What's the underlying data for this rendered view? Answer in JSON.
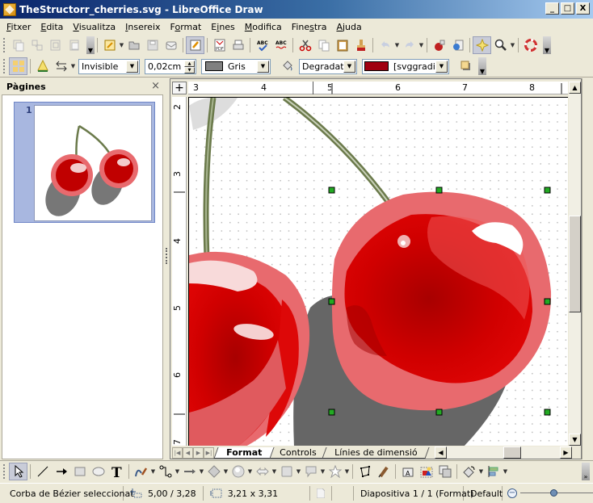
{
  "window": {
    "title": "TheStructorr_cherries.svg - LibreOffice Draw",
    "minimize_label": "_",
    "maximize_label": "□",
    "close_label": "X"
  },
  "menu": [
    {
      "label": "Fitxer",
      "accel": "F"
    },
    {
      "label": "Edita",
      "accel": "E"
    },
    {
      "label": "Visualitza",
      "accel": "V"
    },
    {
      "label": "Insereix",
      "accel": "I"
    },
    {
      "label": "Format",
      "accel": "o"
    },
    {
      "label": "Eines",
      "accel": "i"
    },
    {
      "label": "Modifica",
      "accel": "M"
    },
    {
      "label": "Finestra",
      "accel": "s"
    },
    {
      "label": "Ajuda",
      "accel": "A"
    }
  ],
  "standard_toolbar": {
    "icons": [
      "copy-slide-icon",
      "duplicate-icon",
      "copy-icon",
      "paste-special-icon",
      "new-icon",
      "open-icon",
      "save-icon",
      "email-icon",
      "edit-file-icon",
      "export-pdf-icon",
      "print-icon",
      "spellcheck-icon",
      "autospellcheck-icon",
      "cut-icon",
      "copy-icon",
      "paste-icon",
      "clone-formatting-icon",
      "undo-icon",
      "redo-icon",
      "gallery-icon",
      "navigator-icon",
      "functions-icon",
      "zoom-icon",
      "help-icon"
    ]
  },
  "line_fill_toolbar": {
    "line_style": "Invisible",
    "line_width": "0,02cm",
    "line_color_name": "Gris",
    "line_color": "#808080",
    "area_style": "Degradat",
    "area_fill_name": "[svggradier",
    "area_fill_color": "#a00010"
  },
  "pages_panel": {
    "title": "Pàgines",
    "close_label": "×",
    "slides": [
      {
        "number": "1"
      }
    ]
  },
  "rulers": {
    "horizontal": [
      "3",
      "4",
      "5",
      "6",
      "7",
      "8"
    ],
    "vertical": [
      "2",
      "3",
      "4",
      "5",
      "6",
      "7"
    ]
  },
  "layer_tabs": [
    {
      "label": "Format",
      "active": true
    },
    {
      "label": "Controls",
      "active": false
    },
    {
      "label": "Línies de dimensió",
      "active": false
    }
  ],
  "status": {
    "selection": "Corba de Bézier seleccionat",
    "position": "5,00 / 3,28",
    "size": "3,21 x 3,31",
    "slide": "Diapositiva 1 / 1 (Format)",
    "master": "Default",
    "zoom_fraction": 0.45
  },
  "colors": {
    "cherry_red": "#cc0000",
    "cherry_highlight": "#e86a6e",
    "stem": "#6b7a4b",
    "shadow": "#666666",
    "handle": "#22aa22"
  }
}
